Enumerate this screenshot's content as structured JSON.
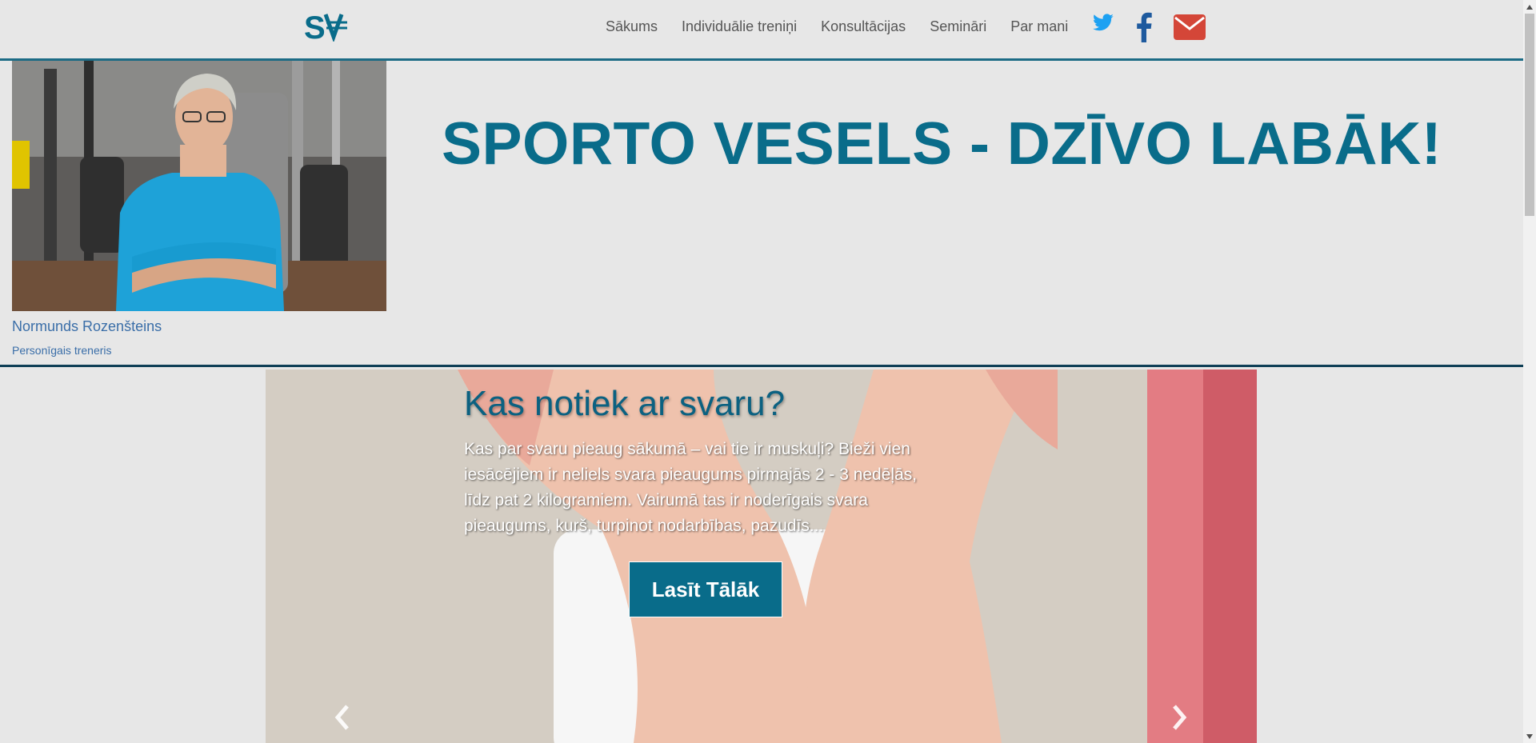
{
  "nav": {
    "links": [
      "Sākums",
      "Individuālie treniņi",
      "Konsultācijas",
      "Semināri",
      "Par mani"
    ]
  },
  "colors": {
    "brand": "#096c8a",
    "twitter": "#1da1f2",
    "facebook": "#1e5a9e",
    "email": "#d44638",
    "border": "#1c6b85",
    "link": "#3a6ea8"
  },
  "icons": {
    "logo": "sv-logo-icon",
    "twitter": "twitter-icon",
    "facebook": "facebook-icon",
    "email": "envelope-icon",
    "prev": "chevron-left-icon",
    "next": "chevron-right-icon"
  },
  "header": {
    "trainer_name": "Normunds Rozenšteins",
    "trainer_role": "Personīgais treneris",
    "headline": "SPORTO VESELS - DZĪVO LABĀK!"
  },
  "carousel": {
    "title": "Kas notiek ar svaru?",
    "text": "Kas par svaru pieaug sākumā – vai tie ir muskuļi? Bieži vien iesācējiem ir neliels svara pieaugums pirmajās 2 - 3 nedēļās, līdz pat 2 kilogramiem. Vairumā tas ir noderīgais svara pieaugums, kurš, turpinot nodarbības, pazudīs...",
    "button_label": "Lasīt Tālāk"
  }
}
